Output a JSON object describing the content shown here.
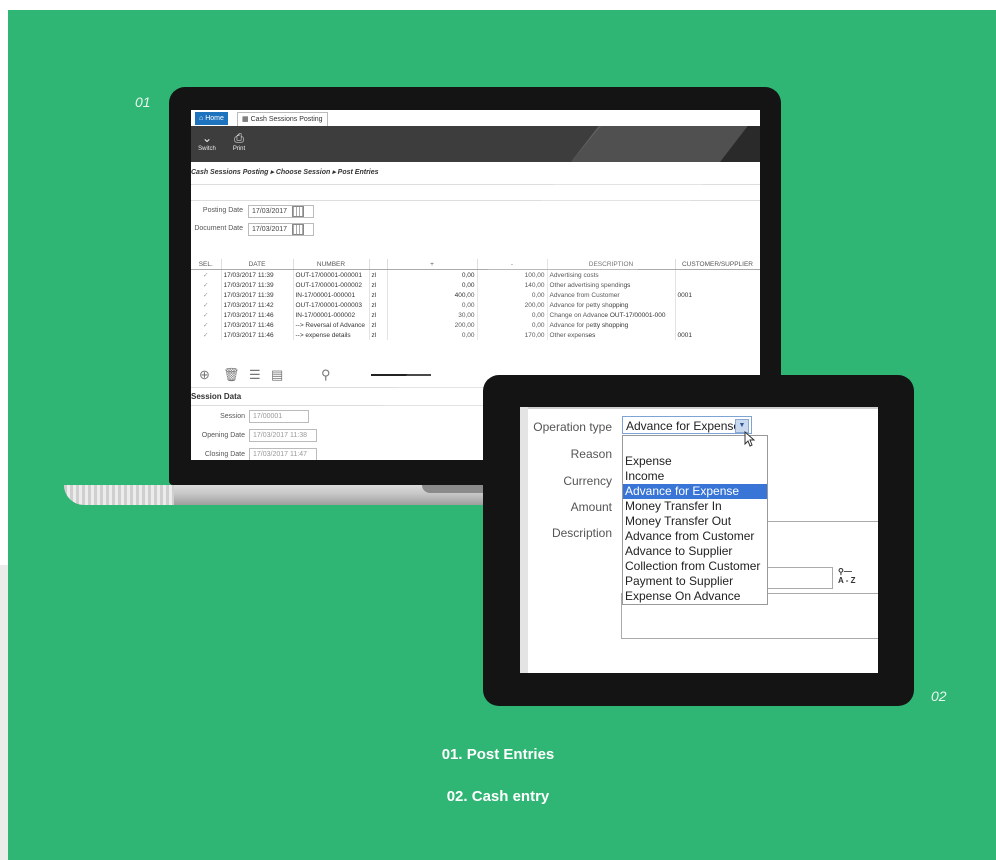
{
  "labels": {
    "first": "01",
    "second": "02"
  },
  "laptop": {
    "tabs": {
      "home": "Home",
      "cash": "Cash Sessions Posting"
    },
    "toolbar": {
      "switch": "Switch",
      "print": "Print"
    },
    "breadcrumb": "Cash Sessions Posting  ▸  Choose Session  ▸  Post Entries",
    "posting_date_label": "Posting Date",
    "posting_date": "17/03/2017",
    "document_date_label": "Document Date",
    "document_date": "17/03/2017",
    "columns": [
      "SEL.",
      "DATE",
      "NUMBER",
      "",
      "+",
      "-",
      "DESCRIPTION",
      "CUSTOMER/SUPPLIER"
    ],
    "rows": [
      {
        "sel": "✓",
        "date": "17/03/2017 11:39",
        "number": "OUT-17/00001-000001",
        "cur": "zl",
        "plus": "0,00",
        "minus": "100,00",
        "desc": "Advertising costs",
        "cust": ""
      },
      {
        "sel": "✓",
        "date": "17/03/2017 11:39",
        "number": "OUT-17/00001-000002",
        "cur": "zl",
        "plus": "0,00",
        "minus": "140,00",
        "desc": "Other advertising spendings",
        "cust": ""
      },
      {
        "sel": "✓",
        "date": "17/03/2017 11:39",
        "number": "IN-17/00001-000001",
        "cur": "zl",
        "plus": "400,00",
        "minus": "0,00",
        "desc": "Advance from Customer",
        "cust": "0001"
      },
      {
        "sel": "✓",
        "date": "17/03/2017 11:42",
        "number": "OUT-17/00001-000003",
        "cur": "zl",
        "plus": "0,00",
        "minus": "200,00",
        "desc": "Advance for petty shopping",
        "cust": ""
      },
      {
        "sel": "✓",
        "date": "17/03/2017 11:46",
        "number": "IN-17/00001-000002",
        "cur": "zl",
        "plus": "30,00",
        "minus": "0,00",
        "desc": "Change on Advance OUT-17/00001-000",
        "cust": ""
      },
      {
        "sel": "✓",
        "date": "17/03/2017 11:46",
        "number": "--> Reversal of Advance",
        "cur": "zl",
        "plus": "200,00",
        "minus": "0,00",
        "desc": "Advance for petty shopping",
        "cust": ""
      },
      {
        "sel": "✓",
        "date": "17/03/2017 11:46",
        "number": "--> expense details",
        "cur": "zl",
        "plus": "0,00",
        "minus": "170,00",
        "desc": "Other expenses",
        "cust": "0001"
      }
    ],
    "section_title": "Session Data",
    "session_label": "Session",
    "session": "17/00001",
    "opening_label": "Opening Date",
    "opening": "17/03/2017 11:38",
    "closing_label": "Closing Date",
    "closing": "17/03/2017 11:47"
  },
  "tablet": {
    "operation_type_label": "Operation type",
    "operation_type_value": "Advance for Expense",
    "reason_label": "Reason",
    "currency_label": "Currency",
    "amount_label": "Amount",
    "description_label": "Description",
    "options": [
      "Expense",
      "Income",
      "Advance for Expense",
      "Money Transfer In",
      "Money Transfer Out",
      "Advance from Customer",
      "Advance to Supplier",
      "Collection from Customer",
      "Payment to Supplier",
      "Expense On Advance"
    ],
    "selected_index": 2,
    "az": "A - Z"
  },
  "captions": {
    "first": "01. Post Entries",
    "second": "02. Cash entry"
  },
  "colors": {
    "background": "#2fb574",
    "selection": "#3875d7",
    "home_tab": "#1e73be"
  }
}
